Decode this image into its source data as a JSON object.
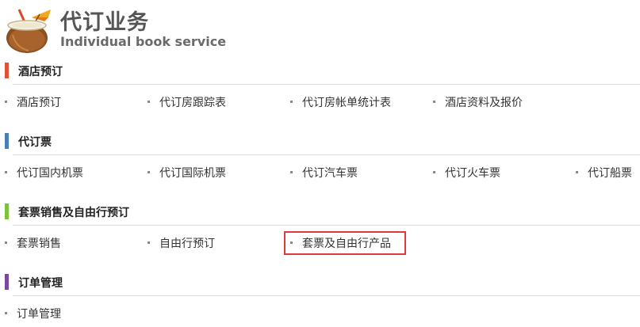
{
  "header": {
    "title": "代订业务",
    "subtitle": "Individual book service",
    "logo_icon": "coconut-drink-icon"
  },
  "sections": [
    {
      "title": "酒店预订",
      "color": "#e0513a",
      "items": [
        "酒店预订",
        "代订房跟踪表",
        "代订房帐单统计表",
        "酒店资料及报价"
      ]
    },
    {
      "title": "代订票",
      "color": "#4a7fb5",
      "items": [
        "代订国内机票",
        "代订国际机票",
        "代订汽车票",
        "代订火车票",
        "代订船票"
      ]
    },
    {
      "title": "套票销售及自由行预订",
      "color": "#7cc23a",
      "items": [
        "套票销售",
        "自由行预订",
        "套票及自由行产品"
      ]
    },
    {
      "title": "订单管理",
      "color": "#7a4a9a",
      "items": [
        "订单管理"
      ]
    }
  ],
  "highlight_color": "#e0393e"
}
